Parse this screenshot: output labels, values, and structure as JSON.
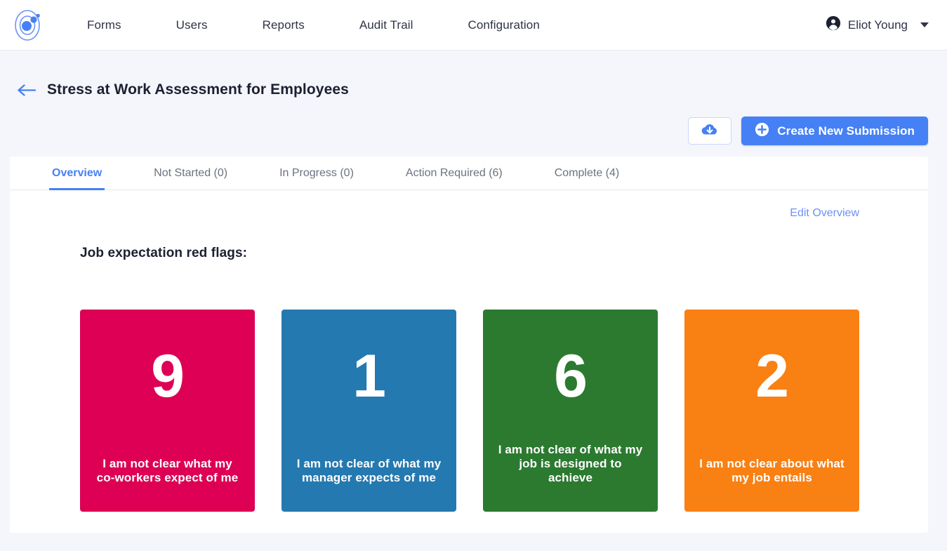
{
  "header": {
    "logo_icon": "atom-logo-icon",
    "nav": [
      {
        "label": "Forms"
      },
      {
        "label": "Users"
      },
      {
        "label": "Reports"
      },
      {
        "label": "Audit Trail"
      },
      {
        "label": "Configuration"
      }
    ],
    "account": {
      "icon": "account-circle-icon",
      "name": "Eliot Young",
      "caret_icon": "chevron-down-icon"
    }
  },
  "page": {
    "back_icon": "arrow-left-icon",
    "title": "Stress at Work Assessment for Employees",
    "actions": {
      "download_icon": "cloud-download-icon",
      "create_icon": "plus-circle-icon",
      "create_label": "Create New Submission"
    }
  },
  "tabs": [
    {
      "label": "Overview",
      "active": true
    },
    {
      "label": "Not Started (0)",
      "active": false
    },
    {
      "label": "In Progress (0)",
      "active": false
    },
    {
      "label": "Action Required (6)",
      "active": false
    },
    {
      "label": "Complete (4)",
      "active": false
    }
  ],
  "overview": {
    "edit_link": "Edit Overview",
    "section_title": "Job expectation red flags:",
    "cards": [
      {
        "value": "9",
        "label": "I am not clear what my co-workers expect of me",
        "color": "#dd0055"
      },
      {
        "value": "1",
        "label": "I am not clear of what my manager expects of me",
        "color": "#2479b0"
      },
      {
        "value": "6",
        "label": "I am not clear of what my job is designed to achieve",
        "color": "#2b7a30"
      },
      {
        "value": "2",
        "label": "I am not clear about what my job entails",
        "color": "#f98012"
      }
    ]
  },
  "colors": {
    "accent": "#4680f5",
    "page_bg": "#f4f6fb",
    "text": "#2e3446"
  }
}
